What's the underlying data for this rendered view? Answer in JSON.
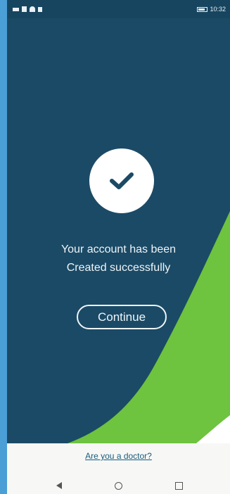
{
  "status_bar": {
    "left_text": "",
    "right_text": "10:32"
  },
  "success_screen": {
    "message_line1": "Your account has been",
    "message_line2": "Created successfully",
    "continue_label": "Continue"
  },
  "footer": {
    "doctor_link": "Are you a doctor?"
  },
  "colors": {
    "background_blue": "#1b4a66",
    "accent_green": "#6ec33f",
    "page_background": "#4a9fd6",
    "footer_background": "#f7f8f6",
    "link_color": "#195c7c"
  },
  "icons": {
    "success_icon": "checkmark-icon",
    "nav_back": "triangle-left-icon",
    "nav_home": "circle-icon",
    "nav_recent": "square-icon"
  }
}
